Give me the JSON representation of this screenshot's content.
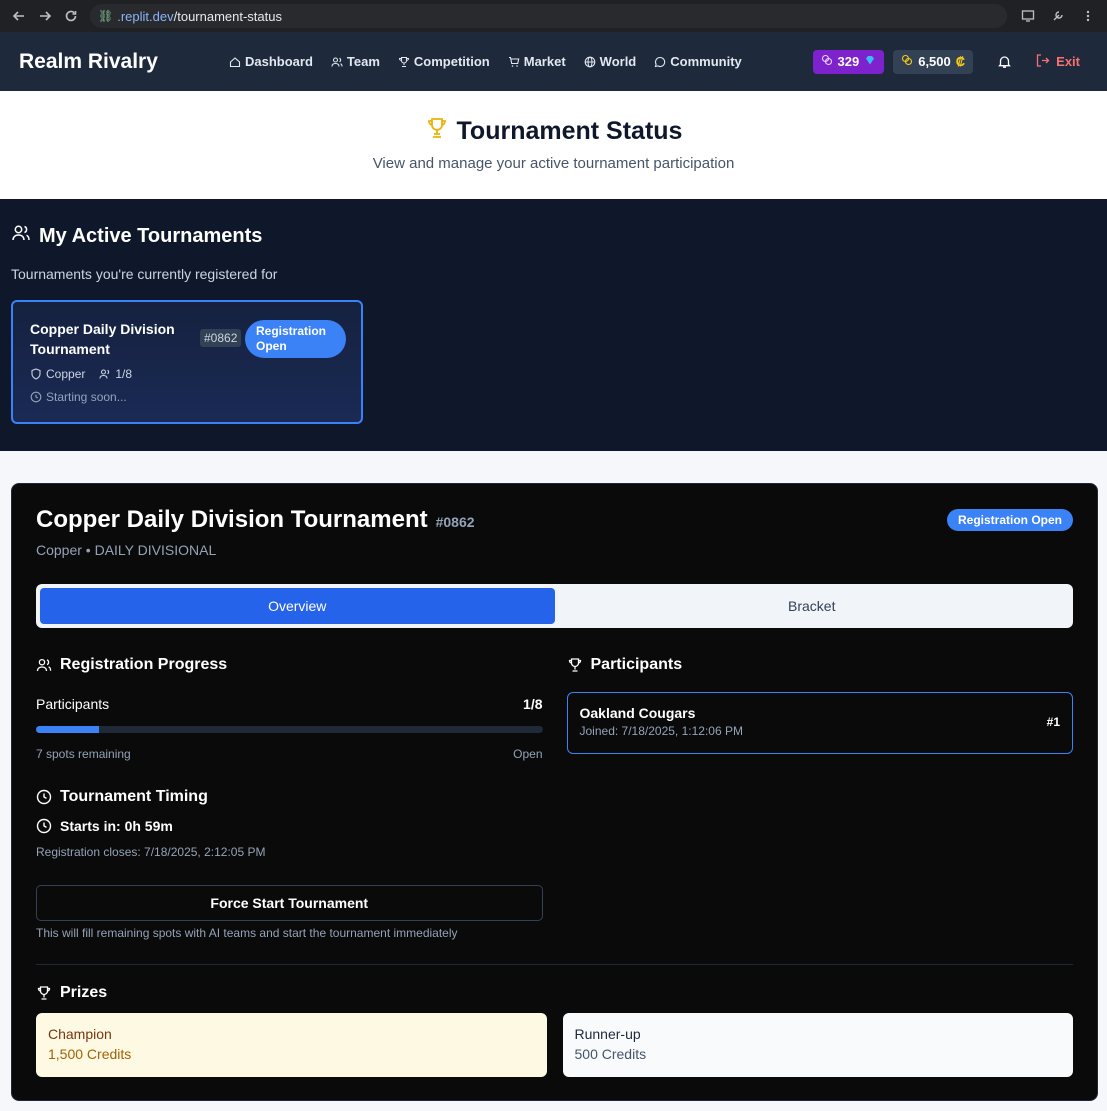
{
  "browser": {
    "url_domain": ".replit.dev",
    "url_path": "/tournament-status"
  },
  "header": {
    "brand": "Realm Rivalry",
    "nav": [
      {
        "label": "Dashboard",
        "icon": "home-icon"
      },
      {
        "label": "Team",
        "icon": "users-icon"
      },
      {
        "label": "Competition",
        "icon": "trophy-icon"
      },
      {
        "label": "Market",
        "icon": "cart-icon"
      },
      {
        "label": "World",
        "icon": "globe-icon"
      },
      {
        "label": "Community",
        "icon": "chat-icon"
      }
    ],
    "gems": "329",
    "credits": "6,500",
    "credit_symbol": "₡",
    "exit": "Exit"
  },
  "page": {
    "title": "Tournament Status",
    "subtitle": "View and manage your active tournament participation"
  },
  "active": {
    "title": "My Active Tournaments",
    "subtitle": "Tournaments you're currently registered for",
    "card": {
      "name": "Copper Daily Division Tournament",
      "id": "#0862",
      "badge": "Registration Open",
      "division": "Copper",
      "count": "1/8",
      "time": "Starting soon..."
    }
  },
  "details": {
    "title": "Copper Daily Division Tournament",
    "id": "#0862",
    "badge": "Registration Open",
    "subtitle": "Copper • DAILY DIVISIONAL",
    "tabs": [
      "Overview",
      "Bracket"
    ],
    "registration": {
      "title": "Registration Progress",
      "label": "Participants",
      "count": "1/8",
      "progress_fraction": 0.125,
      "remaining": "7 spots remaining",
      "status": "Open"
    },
    "timing": {
      "title": "Tournament Timing",
      "starts": "Starts in: 0h 59m",
      "closes": "Registration closes: 7/18/2025, 2:12:05 PM"
    },
    "force_button": "Force Start Tournament",
    "force_note": "This will fill remaining spots with AI teams and start the tournament immediately",
    "participants": {
      "title": "Participants",
      "items": [
        {
          "name": "Oakland Cougars",
          "joined": "Joined: 7/18/2025, 1:12:06 PM",
          "rank": "#1"
        }
      ]
    },
    "prizes": {
      "title": "Prizes",
      "items": [
        {
          "label": "Champion",
          "value": "1,500 Credits"
        },
        {
          "label": "Runner-up",
          "value": "500 Credits"
        }
      ]
    }
  },
  "colors": {
    "accent": "#3b82f6",
    "header_bg": "#1e293b",
    "gems_bg": "#7e22ce"
  }
}
